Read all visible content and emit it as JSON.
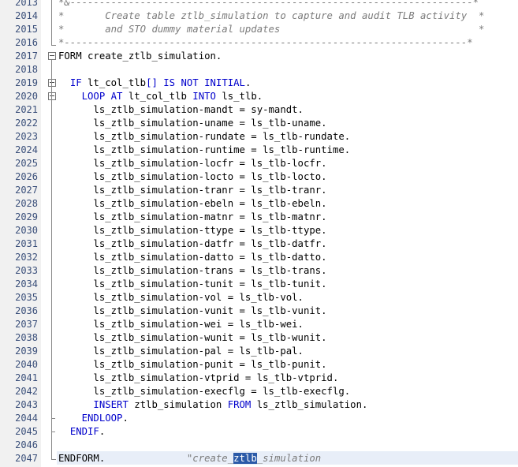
{
  "editor": {
    "lines": [
      {
        "num": "2013",
        "parts": [
          {
            "t": "*&---------------------------------------------------------------------*",
            "c": "cm"
          }
        ]
      },
      {
        "num": "2014",
        "parts": [
          {
            "t": "*       Create table ztlb_simulation to capture and audit TLB activity  *",
            "c": "cm"
          }
        ]
      },
      {
        "num": "2015",
        "parts": [
          {
            "t": "*       and STO dummy material updates                                  *",
            "c": "cm"
          }
        ]
      },
      {
        "num": "2016",
        "parts": [
          {
            "t": "*---------------------------------------------------------------------*",
            "c": "cm"
          }
        ]
      },
      {
        "num": "2017",
        "parts": [
          {
            "t": "FORM",
            "c": ""
          },
          {
            "t": " create_ztlb_simulation.",
            "c": ""
          }
        ]
      },
      {
        "num": "2018",
        "parts": []
      },
      {
        "num": "2019",
        "parts": [
          {
            "t": "  ",
            "c": ""
          },
          {
            "t": "IF",
            "c": "kw"
          },
          {
            "t": " lt_col_tlb",
            "c": ""
          },
          {
            "t": "[]",
            "c": "kw"
          },
          {
            "t": " ",
            "c": ""
          },
          {
            "t": "IS NOT INITIAL",
            "c": "kw"
          },
          {
            "t": ".",
            "c": ""
          }
        ]
      },
      {
        "num": "2020",
        "parts": [
          {
            "t": "    ",
            "c": ""
          },
          {
            "t": "LOOP AT",
            "c": "kw"
          },
          {
            "t": " lt_col_tlb ",
            "c": ""
          },
          {
            "t": "INTO",
            "c": "kw"
          },
          {
            "t": " ls_tlb.",
            "c": ""
          }
        ]
      },
      {
        "num": "2021",
        "parts": [
          {
            "t": "      ls_ztlb_simulation-mandt = sy-mandt.",
            "c": ""
          }
        ]
      },
      {
        "num": "2022",
        "parts": [
          {
            "t": "      ls_ztlb_simulation-uname = ls_tlb-uname.",
            "c": ""
          }
        ]
      },
      {
        "num": "2023",
        "parts": [
          {
            "t": "      ls_ztlb_simulation-rundate = ls_tlb-rundate.",
            "c": ""
          }
        ]
      },
      {
        "num": "2024",
        "parts": [
          {
            "t": "      ls_ztlb_simulation-runtime = ls_tlb-runtime.",
            "c": ""
          }
        ]
      },
      {
        "num": "2025",
        "parts": [
          {
            "t": "      ls_ztlb_simulation-locfr = ls_tlb-locfr.",
            "c": ""
          }
        ]
      },
      {
        "num": "2026",
        "parts": [
          {
            "t": "      ls_ztlb_simulation-locto = ls_tlb-locto.",
            "c": ""
          }
        ]
      },
      {
        "num": "2027",
        "parts": [
          {
            "t": "      ls_ztlb_simulation-tranr = ls_tlb-tranr.",
            "c": ""
          }
        ]
      },
      {
        "num": "2028",
        "parts": [
          {
            "t": "      ls_ztlb_simulation-ebeln = ls_tlb-ebeln.",
            "c": ""
          }
        ]
      },
      {
        "num": "2029",
        "parts": [
          {
            "t": "      ls_ztlb_simulation-matnr = ls_tlb-matnr.",
            "c": ""
          }
        ]
      },
      {
        "num": "2030",
        "parts": [
          {
            "t": "      ls_ztlb_simulation-ttype = ls_tlb-ttype.",
            "c": ""
          }
        ]
      },
      {
        "num": "2031",
        "parts": [
          {
            "t": "      ls_ztlb_simulation-datfr = ls_tlb-datfr.",
            "c": ""
          }
        ]
      },
      {
        "num": "2032",
        "parts": [
          {
            "t": "      ls_ztlb_simulation-datto = ls_tlb-datto.",
            "c": ""
          }
        ]
      },
      {
        "num": "2033",
        "parts": [
          {
            "t": "      ls_ztlb_simulation-trans = ls_tlb-trans.",
            "c": ""
          }
        ]
      },
      {
        "num": "2034",
        "parts": [
          {
            "t": "      ls_ztlb_simulation-tunit = ls_tlb-tunit.",
            "c": ""
          }
        ]
      },
      {
        "num": "2035",
        "parts": [
          {
            "t": "      ls_ztlb_simulation-vol = ls_tlb-vol.",
            "c": ""
          }
        ]
      },
      {
        "num": "2036",
        "parts": [
          {
            "t": "      ls_ztlb_simulation-vunit = ls_tlb-vunit.",
            "c": ""
          }
        ]
      },
      {
        "num": "2037",
        "parts": [
          {
            "t": "      ls_ztlb_simulation-wei = ls_tlb-wei.",
            "c": ""
          }
        ]
      },
      {
        "num": "2038",
        "parts": [
          {
            "t": "      ls_ztlb_simulation-wunit = ls_tlb-wunit.",
            "c": ""
          }
        ]
      },
      {
        "num": "2039",
        "parts": [
          {
            "t": "      ls_ztlb_simulation-pal = ls_tlb-pal.",
            "c": ""
          }
        ]
      },
      {
        "num": "2040",
        "parts": [
          {
            "t": "      ls_ztlb_simulation-punit = ls_tlb-punit.",
            "c": ""
          }
        ]
      },
      {
        "num": "2041",
        "parts": [
          {
            "t": "      ls_ztlb_simulation-vtprid = ls_tlb-vtprid.",
            "c": ""
          }
        ]
      },
      {
        "num": "2042",
        "parts": [
          {
            "t": "      ls_ztlb_simulation-execflg = ls_tlb-execflg.",
            "c": ""
          }
        ]
      },
      {
        "num": "2043",
        "parts": [
          {
            "t": "      ",
            "c": ""
          },
          {
            "t": "INSERT",
            "c": "kw"
          },
          {
            "t": " ztlb_simulation ",
            "c": ""
          },
          {
            "t": "FROM",
            "c": "kw"
          },
          {
            "t": " ls_ztlb_simulation.",
            "c": ""
          }
        ]
      },
      {
        "num": "2044",
        "parts": [
          {
            "t": "    ",
            "c": ""
          },
          {
            "t": "ENDLOOP",
            "c": "kw"
          },
          {
            "t": ".",
            "c": ""
          }
        ]
      },
      {
        "num": "2045",
        "parts": [
          {
            "t": "  ",
            "c": ""
          },
          {
            "t": "ENDIF",
            "c": "kw"
          },
          {
            "t": ".",
            "c": ""
          }
        ]
      },
      {
        "num": "2046",
        "parts": []
      },
      {
        "num": "2047",
        "parts": [
          {
            "t": "ENDFORM",
            "c": ""
          },
          {
            "t": ".              ",
            "c": ""
          },
          {
            "t": "\"create_",
            "c": "cm"
          },
          {
            "t": "ztlb",
            "c": "hl"
          },
          {
            "t": "_simulation",
            "c": "cm"
          }
        ]
      }
    ]
  },
  "colors": {
    "keyword": "#0000cc",
    "comment": "#7b7b7b",
    "line_number": "#3a4f7a",
    "selection": "#2b5aa8"
  }
}
